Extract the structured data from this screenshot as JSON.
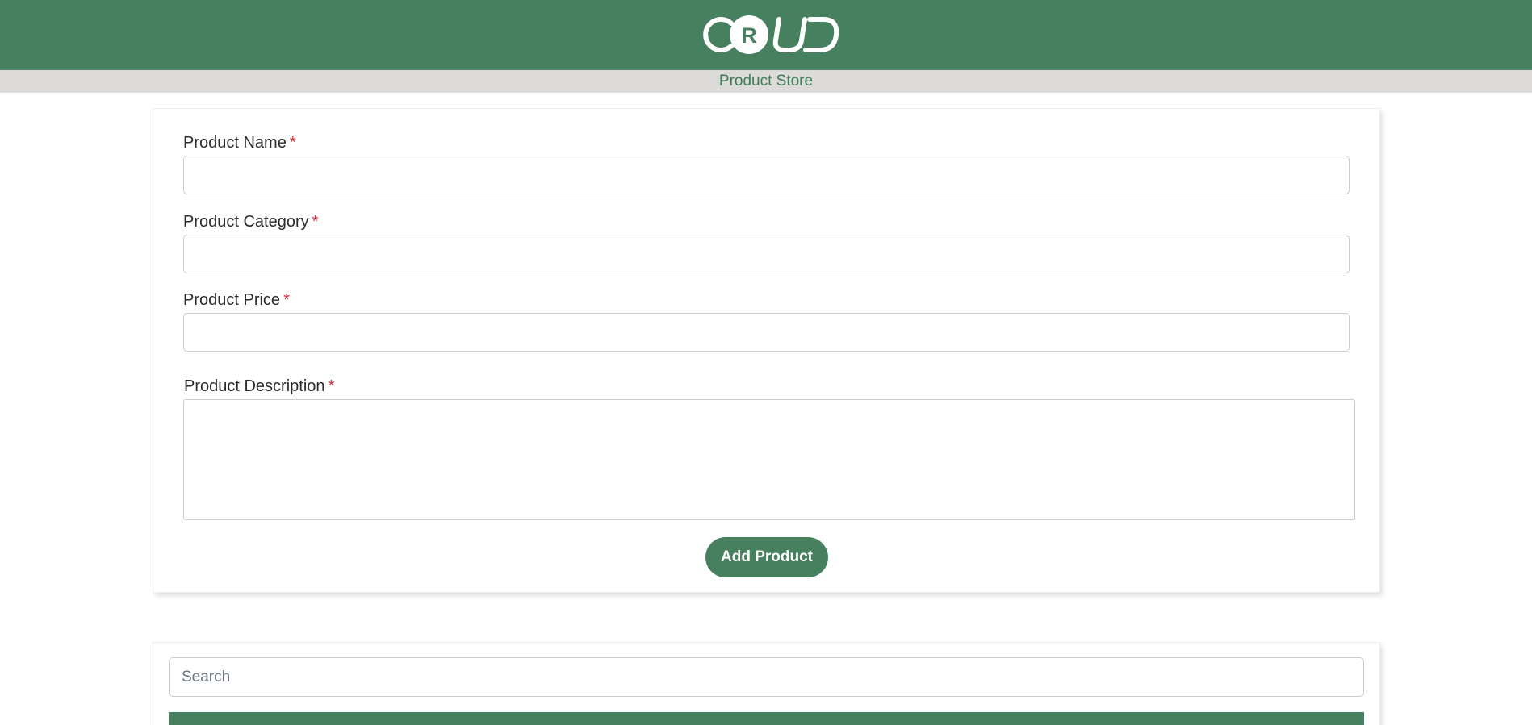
{
  "header": {
    "logo_icon": "crud-logo",
    "logo_text": "CRUD",
    "subtitle": "Product Store",
    "colors": {
      "primary": "#46805e",
      "subbar": "#dcdbd9",
      "required": "#e0283a"
    }
  },
  "form": {
    "fields": [
      {
        "label": "Product Name",
        "required_mark": "*",
        "value": ""
      },
      {
        "label": "Product Category",
        "required_mark": "*",
        "value": ""
      },
      {
        "label": "Product Price",
        "required_mark": "*",
        "value": ""
      },
      {
        "label": "Product Description",
        "required_mark": "*",
        "value": ""
      }
    ],
    "submit_label": "Add Product"
  },
  "list": {
    "search_placeholder": "Search",
    "search_value": ""
  }
}
